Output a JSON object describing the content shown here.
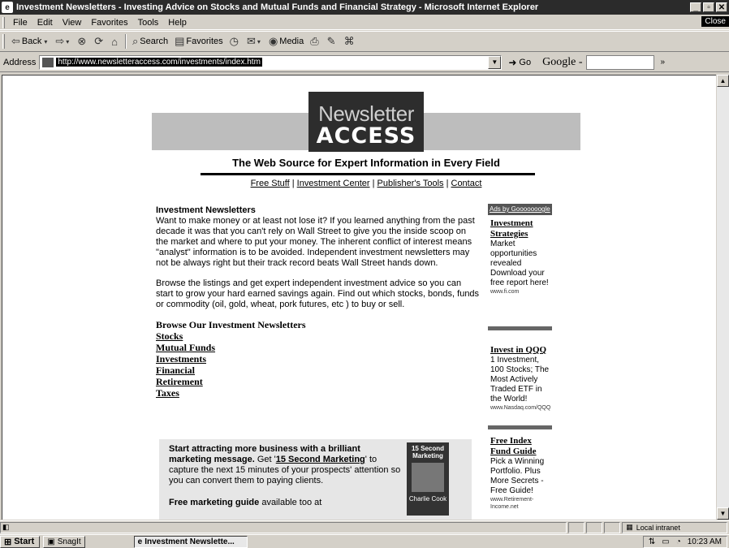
{
  "window": {
    "title": "Investment Newsletters - Investing Advice on Stocks and Mutual Funds and Financial Strategy - Microsoft Internet Explorer",
    "close_label": "Close"
  },
  "menu": [
    "File",
    "Edit",
    "View",
    "Favorites",
    "Tools",
    "Help"
  ],
  "toolbar": {
    "back": "Back",
    "search": "Search",
    "favorites": "Favorites",
    "media": "Media"
  },
  "address": {
    "label": "Address",
    "url": "http://www.newsletteraccess.com/investments/index.htm",
    "go": "Go",
    "google": "Google -"
  },
  "logo": {
    "line1": "Newsletter",
    "line2": "ACCESS"
  },
  "tagline": "The Web Source for Expert Information in Every Field",
  "nav": {
    "free_stuff": "Free Stuff",
    "investment_center": "Investment Center",
    "publishers_tools": "Publisher's Tools",
    "contact": "Contact",
    "sep": " | "
  },
  "main": {
    "heading": "Investment Newsletters",
    "para1": "Want to make money or at least not lose it? If you learned anything from the past decade it was that you can't rely on Wall Street to give you the inside scoop on the market and where to put your money. The inherent conflict of interest means \"analyst\" information is to be avoided. Independent investment newsletters may not be always right but their track record beats Wall Street hands down.",
    "para2": "Browse the listings and get expert independent investment advice so you can start to grow your hard earned savings again. Find out which stocks, bonds, funds or commodity (oil, gold, wheat, pork futures, etc ) to buy or sell.",
    "browse_heading": "Browse Our Investment Newsletters",
    "categories": [
      "Stocks",
      "Mutual Funds",
      "Investments",
      "Financial",
      "Retirement",
      "Taxes"
    ]
  },
  "promo": {
    "bold1": "Start attracting more business with a brilliant marketing message.",
    "text1": " Get '",
    "link": "15 Second Marketing",
    "text2": "' to capture the next 15 minutes of your prospects' attention so you can convert them to paying clients.",
    "guide_bold": "Free marketing guide",
    "guide_text": " available too at",
    "book_title": "15 Second Marketing",
    "book_author": "Charlie Cook"
  },
  "ads": {
    "header": "Ads by Gooooooogle",
    "items": [
      {
        "title": "Investment Strategies",
        "desc": "Market opportunities revealed Download your free report here!",
        "url": "www.fi.com"
      },
      {
        "title": "Invest in QQQ",
        "desc": "1 Investment, 100 Stocks; The Most Actively Traded ETF in the World!",
        "url": "www.Nasdaq.com/QQQ"
      },
      {
        "title": "Free Index Fund Guide",
        "desc": "Pick a Winning Portfolio. Plus More Secrets - Free Guide!",
        "url": "www.Retirement-Income.net"
      }
    ]
  },
  "status": {
    "zone": "Local intranet"
  },
  "taskbar": {
    "start": "Start",
    "snagit": "SnagIt",
    "active_task": "Investment Newslette...",
    "clock": "10:23 AM"
  }
}
